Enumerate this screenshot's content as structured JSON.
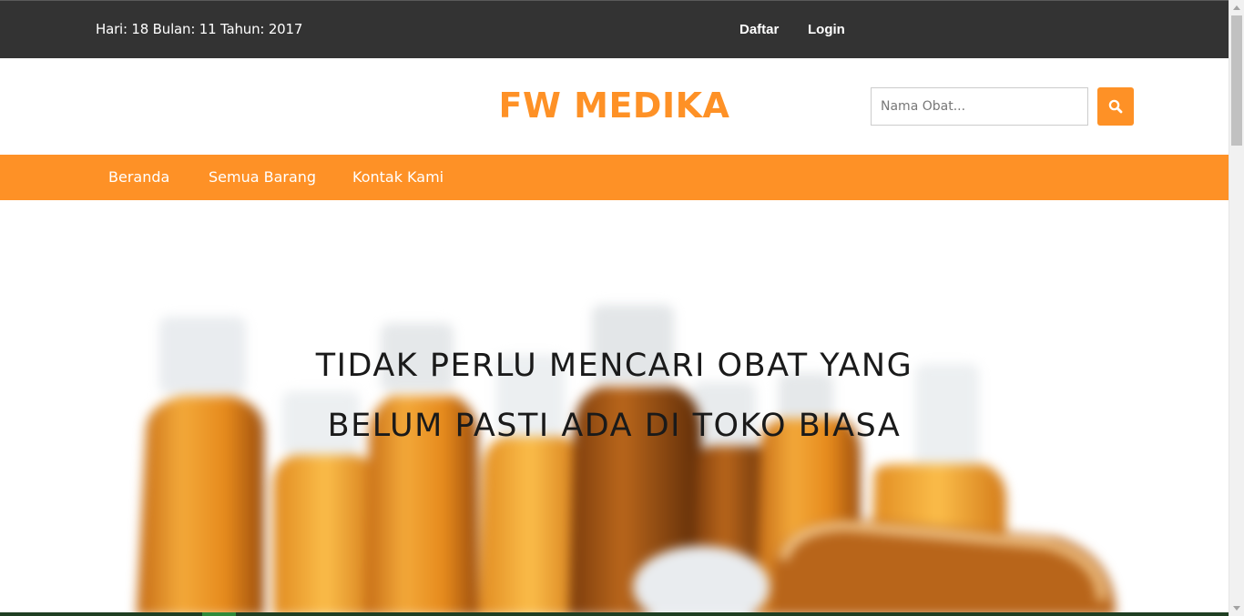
{
  "topbar": {
    "date_text": "Hari: 18 Bulan: 11 Tahun: 2017",
    "daftar_label": "Daftar",
    "login_label": "Login"
  },
  "header": {
    "brand": "FW MEDIKA",
    "search_placeholder": "Nama Obat...",
    "search_icon": "search-icon"
  },
  "nav": {
    "items": [
      {
        "label": "Beranda"
      },
      {
        "label": "Semua Barang"
      },
      {
        "label": "Kontak Kami"
      }
    ]
  },
  "hero": {
    "line1": "TIDAK PERLU MENCARI OBAT YANG",
    "line2": "BELUM PASTI ADA DI TOKO BIASA"
  },
  "colors": {
    "accent": "#fe9126",
    "topbar": "#333333"
  }
}
